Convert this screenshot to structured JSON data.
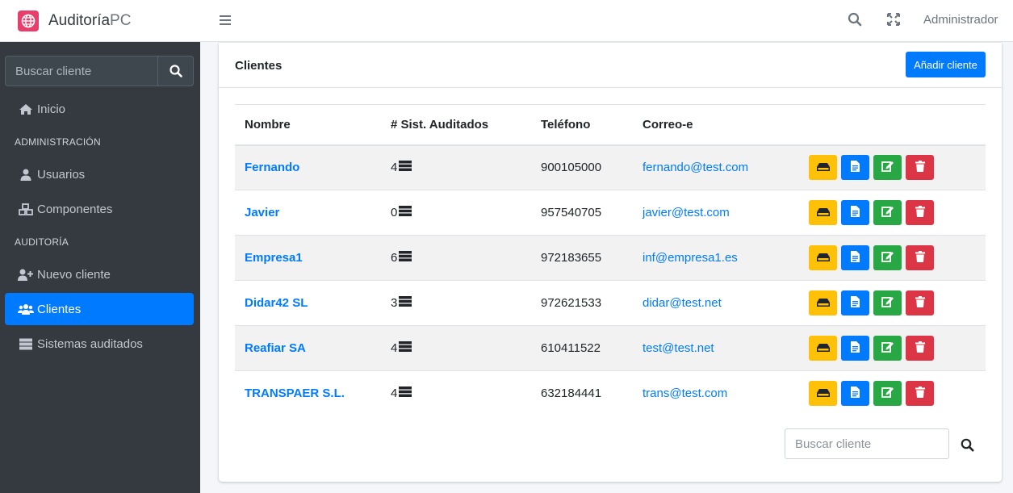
{
  "brand": {
    "name_bold": "Auditoría",
    "name_light": "PC"
  },
  "sidebar": {
    "search_placeholder": "Buscar cliente",
    "items": [
      {
        "label": "Inicio",
        "icon": "home-icon"
      },
      {
        "label": "Usuarios",
        "icon": "user-icon"
      },
      {
        "label": "Componentes",
        "icon": "cubes-icon"
      },
      {
        "label": "Nuevo cliente",
        "icon": "user-plus-icon"
      },
      {
        "label": "Clientes",
        "icon": "users-icon",
        "active": true
      },
      {
        "label": "Sistemas auditados",
        "icon": "server-icon"
      }
    ],
    "headers": [
      "ADMINISTRACIÓN",
      "AUDITORÍA"
    ]
  },
  "topbar": {
    "user": "Administrador"
  },
  "card": {
    "title": "Clientes",
    "add_button": "Añadir cliente",
    "columns": [
      "Nombre",
      "# Sist. Auditados",
      "Teléfono",
      "Correo-e"
    ],
    "rows": [
      {
        "name": "Fernando",
        "count": "4",
        "phone": "900105000",
        "email": "fernando@test.com"
      },
      {
        "name": "Javier",
        "count": "0",
        "phone": "957540705",
        "email": "javier@test.com"
      },
      {
        "name": "Empresa1",
        "count": "6",
        "phone": "972183655",
        "email": "inf@empresa1.es"
      },
      {
        "name": "Didar42 SL",
        "count": "3",
        "phone": "972621533",
        "email": "didar@test.net"
      },
      {
        "name": "Reafiar SA",
        "count": "4",
        "phone": "610411522",
        "email": "test@test.net"
      },
      {
        "name": "TRANSPAER S.L.",
        "count": "4",
        "phone": "632184441",
        "email": "trans@test.com"
      }
    ],
    "search_placeholder": "Buscar cliente"
  },
  "colors": {
    "accent": "#007bff",
    "sidebar_bg": "#343a40",
    "warning": "#ffc107",
    "success": "#28a745",
    "danger": "#dc3545"
  }
}
